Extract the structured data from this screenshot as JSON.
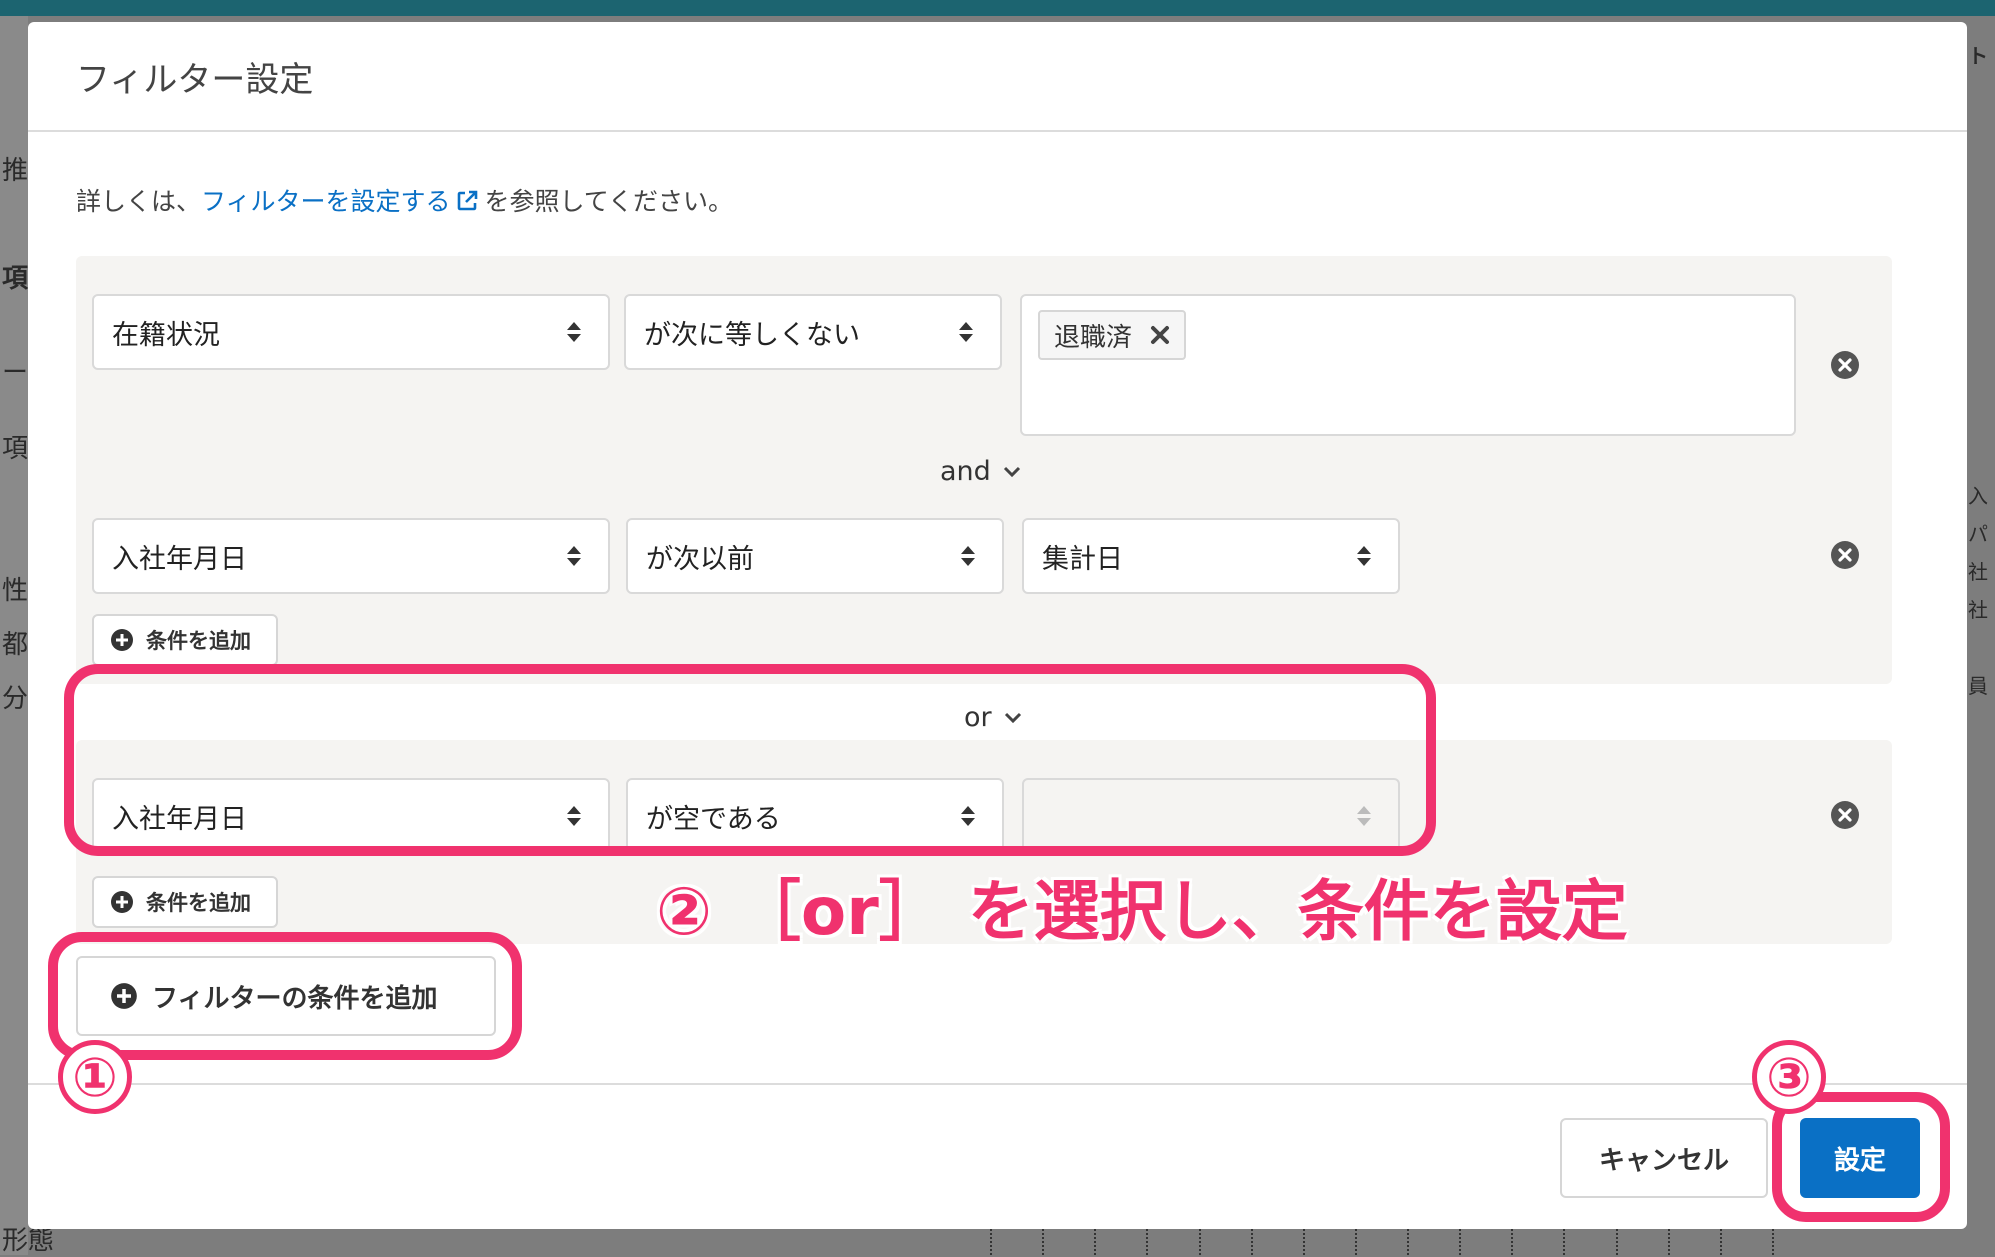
{
  "background": {
    "left_fragments": [
      "推",
      "項",
      "ー",
      "項",
      "性",
      "都",
      "分",
      "形態"
    ],
    "right_fragments": [
      "ト",
      "入",
      "パ",
      "社",
      "社",
      "員"
    ]
  },
  "modal": {
    "title": "フィルター設定",
    "help_prefix": "詳しくは、",
    "help_link": "フィルターを設定する",
    "help_suffix": "を参照してください。"
  },
  "group1": {
    "cond1": {
      "field": "在籍状況",
      "operator": "が次に等しくない",
      "tag": "退職済"
    },
    "connector": "and",
    "cond2": {
      "field": "入社年月日",
      "operator": "が次以前",
      "value": "集計日"
    },
    "add_condition": "条件を追加"
  },
  "group_connector": "or",
  "group2": {
    "cond1": {
      "field": "入社年月日",
      "operator": "が空である",
      "value": ""
    },
    "add_condition": "条件を追加"
  },
  "add_filter_condition": "フィルターの条件を追加",
  "footer": {
    "cancel": "キャンセル",
    "submit": "設定"
  },
  "annotations": {
    "step1": "①",
    "step2_text": "② ［or］ を選択し、条件を設定",
    "step3": "③",
    "color": "#f0326e"
  },
  "colors": {
    "primary": "#0a70c5",
    "header_bar": "#1c6470"
  }
}
